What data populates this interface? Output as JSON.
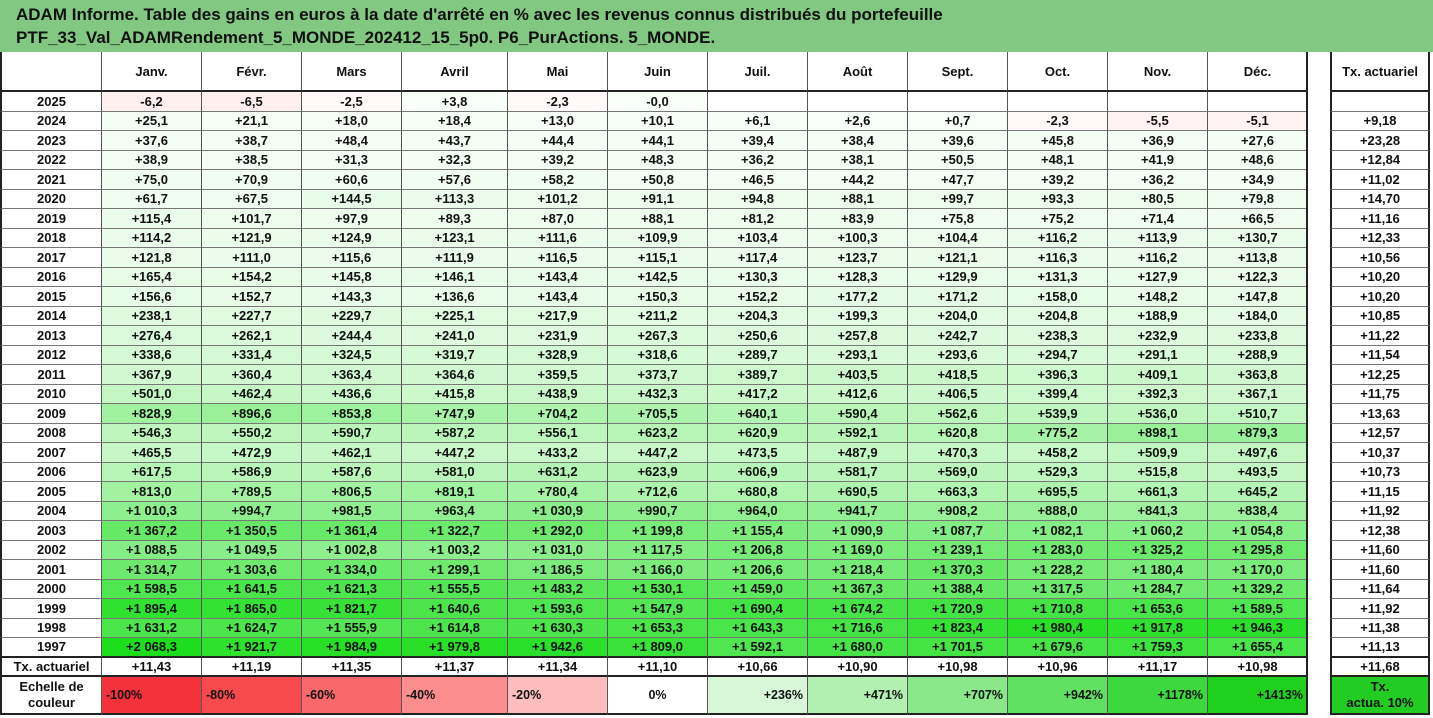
{
  "title_line1": "ADAM Informe. Table des gains en euros à la date d'arrêté en % avec les revenus connus distribués du portefeuille",
  "title_line2": "PTF_33_Val_ADAMRendement_5_MONDE_202412_15_5p0. P6_PurActions. 5_MONDE.",
  "months": [
    "Janv.",
    "Févr.",
    "Mars",
    "Avril",
    "Mai",
    "Juin",
    "Juil.",
    "Août",
    "Sept.",
    "Oct.",
    "Nov.",
    "Déc."
  ],
  "tx_header": "Tx. actuariel",
  "rows": [
    {
      "year": "2025",
      "values": [
        "-6,2",
        "-6,5",
        "-2,5",
        "+3,8",
        "-2,3",
        "-0,0",
        "",
        "",
        "",
        "",
        "",
        ""
      ],
      "tx": ""
    },
    {
      "year": "2024",
      "values": [
        "+25,1",
        "+21,1",
        "+18,0",
        "+18,4",
        "+13,0",
        "+10,1",
        "+6,1",
        "+2,6",
        "+0,7",
        "-2,3",
        "-5,5",
        "-5,1"
      ],
      "tx": "+9,18"
    },
    {
      "year": "2023",
      "values": [
        "+37,6",
        "+38,7",
        "+48,4",
        "+43,7",
        "+44,4",
        "+44,1",
        "+39,4",
        "+38,4",
        "+39,6",
        "+45,8",
        "+36,9",
        "+27,6"
      ],
      "tx": "+23,28"
    },
    {
      "year": "2022",
      "values": [
        "+38,9",
        "+38,5",
        "+31,3",
        "+32,3",
        "+39,2",
        "+48,3",
        "+36,2",
        "+38,1",
        "+50,5",
        "+48,1",
        "+41,9",
        "+48,6"
      ],
      "tx": "+12,84"
    },
    {
      "year": "2021",
      "values": [
        "+75,0",
        "+70,9",
        "+60,6",
        "+57,6",
        "+58,2",
        "+50,8",
        "+46,5",
        "+44,2",
        "+47,7",
        "+39,2",
        "+36,2",
        "+34,9"
      ],
      "tx": "+11,02"
    },
    {
      "year": "2020",
      "values": [
        "+61,7",
        "+67,5",
        "+144,5",
        "+113,3",
        "+101,2",
        "+91,1",
        "+94,8",
        "+88,1",
        "+99,7",
        "+93,3",
        "+80,5",
        "+79,8"
      ],
      "tx": "+14,70"
    },
    {
      "year": "2019",
      "values": [
        "+115,4",
        "+101,7",
        "+97,9",
        "+89,3",
        "+87,0",
        "+88,1",
        "+81,2",
        "+83,9",
        "+75,8",
        "+75,2",
        "+71,4",
        "+66,5"
      ],
      "tx": "+11,16"
    },
    {
      "year": "2018",
      "values": [
        "+114,2",
        "+121,9",
        "+124,9",
        "+123,1",
        "+111,6",
        "+109,9",
        "+103,4",
        "+100,3",
        "+104,4",
        "+116,2",
        "+113,9",
        "+130,7"
      ],
      "tx": "+12,33"
    },
    {
      "year": "2017",
      "values": [
        "+121,8",
        "+111,0",
        "+115,6",
        "+111,9",
        "+116,5",
        "+115,1",
        "+117,4",
        "+123,7",
        "+121,1",
        "+116,3",
        "+116,2",
        "+113,8"
      ],
      "tx": "+10,56"
    },
    {
      "year": "2016",
      "values": [
        "+165,4",
        "+154,2",
        "+145,8",
        "+146,1",
        "+143,4",
        "+142,5",
        "+130,3",
        "+128,3",
        "+129,9",
        "+131,3",
        "+127,9",
        "+122,3"
      ],
      "tx": "+10,20"
    },
    {
      "year": "2015",
      "values": [
        "+156,6",
        "+152,7",
        "+143,3",
        "+136,6",
        "+143,4",
        "+150,3",
        "+152,2",
        "+177,2",
        "+171,2",
        "+158,0",
        "+148,2",
        "+147,8"
      ],
      "tx": "+10,20"
    },
    {
      "year": "2014",
      "values": [
        "+238,1",
        "+227,7",
        "+229,7",
        "+225,1",
        "+217,9",
        "+211,2",
        "+204,3",
        "+199,3",
        "+204,0",
        "+204,8",
        "+188,9",
        "+184,0"
      ],
      "tx": "+10,85"
    },
    {
      "year": "2013",
      "values": [
        "+276,4",
        "+262,1",
        "+244,4",
        "+241,0",
        "+231,9",
        "+267,3",
        "+250,6",
        "+257,8",
        "+242,7",
        "+238,3",
        "+232,9",
        "+233,8"
      ],
      "tx": "+11,22"
    },
    {
      "year": "2012",
      "values": [
        "+338,6",
        "+331,4",
        "+324,5",
        "+319,7",
        "+328,9",
        "+318,6",
        "+289,7",
        "+293,1",
        "+293,6",
        "+294,7",
        "+291,1",
        "+288,9"
      ],
      "tx": "+11,54"
    },
    {
      "year": "2011",
      "values": [
        "+367,9",
        "+360,4",
        "+363,4",
        "+364,6",
        "+359,5",
        "+373,7",
        "+389,7",
        "+403,5",
        "+418,5",
        "+396,3",
        "+409,1",
        "+363,8"
      ],
      "tx": "+12,25"
    },
    {
      "year": "2010",
      "values": [
        "+501,0",
        "+462,4",
        "+436,6",
        "+415,8",
        "+438,9",
        "+432,3",
        "+417,2",
        "+412,6",
        "+406,5",
        "+399,4",
        "+392,3",
        "+367,1"
      ],
      "tx": "+11,75"
    },
    {
      "year": "2009",
      "values": [
        "+828,9",
        "+896,6",
        "+853,8",
        "+747,9",
        "+704,2",
        "+705,5",
        "+640,1",
        "+590,4",
        "+562,6",
        "+539,9",
        "+536,0",
        "+510,7"
      ],
      "tx": "+13,63"
    },
    {
      "year": "2008",
      "values": [
        "+546,3",
        "+550,2",
        "+590,7",
        "+587,2",
        "+556,1",
        "+623,2",
        "+620,9",
        "+592,1",
        "+620,8",
        "+775,2",
        "+898,1",
        "+879,3"
      ],
      "tx": "+12,57"
    },
    {
      "year": "2007",
      "values": [
        "+465,5",
        "+472,9",
        "+462,1",
        "+447,2",
        "+433,2",
        "+447,2",
        "+473,5",
        "+487,9",
        "+470,3",
        "+458,2",
        "+509,9",
        "+497,6"
      ],
      "tx": "+10,37"
    },
    {
      "year": "2006",
      "values": [
        "+617,5",
        "+586,9",
        "+587,6",
        "+581,0",
        "+631,2",
        "+623,9",
        "+606,9",
        "+581,7",
        "+569,0",
        "+529,3",
        "+515,8",
        "+493,5"
      ],
      "tx": "+10,73"
    },
    {
      "year": "2005",
      "values": [
        "+813,0",
        "+789,5",
        "+806,5",
        "+819,1",
        "+780,4",
        "+712,6",
        "+680,8",
        "+690,5",
        "+663,3",
        "+695,5",
        "+661,3",
        "+645,2"
      ],
      "tx": "+11,15"
    },
    {
      "year": "2004",
      "values": [
        "+1 010,3",
        "+994,7",
        "+981,5",
        "+963,4",
        "+1 030,9",
        "+990,7",
        "+964,0",
        "+941,7",
        "+908,2",
        "+888,0",
        "+841,3",
        "+838,4"
      ],
      "tx": "+11,92"
    },
    {
      "year": "2003",
      "values": [
        "+1 367,2",
        "+1 350,5",
        "+1 361,4",
        "+1 322,7",
        "+1 292,0",
        "+1 199,8",
        "+1 155,4",
        "+1 090,9",
        "+1 087,7",
        "+1 082,1",
        "+1 060,2",
        "+1 054,8"
      ],
      "tx": "+12,38"
    },
    {
      "year": "2002",
      "values": [
        "+1 088,5",
        "+1 049,5",
        "+1 002,8",
        "+1 003,2",
        "+1 031,0",
        "+1 117,5",
        "+1 206,8",
        "+1 169,0",
        "+1 239,1",
        "+1 283,0",
        "+1 325,2",
        "+1 295,8"
      ],
      "tx": "+11,60"
    },
    {
      "year": "2001",
      "values": [
        "+1 314,7",
        "+1 303,6",
        "+1 334,0",
        "+1 299,1",
        "+1 186,5",
        "+1 166,0",
        "+1 206,6",
        "+1 218,4",
        "+1 370,3",
        "+1 228,2",
        "+1 180,4",
        "+1 170,0"
      ],
      "tx": "+11,60"
    },
    {
      "year": "2000",
      "values": [
        "+1 598,5",
        "+1 641,5",
        "+1 621,3",
        "+1 555,5",
        "+1 483,2",
        "+1 530,1",
        "+1 459,0",
        "+1 367,3",
        "+1 388,4",
        "+1 317,5",
        "+1 284,7",
        "+1 329,2"
      ],
      "tx": "+11,64"
    },
    {
      "year": "1999",
      "values": [
        "+1 895,4",
        "+1 865,0",
        "+1 821,7",
        "+1 640,6",
        "+1 593,6",
        "+1 547,9",
        "+1 690,4",
        "+1 674,2",
        "+1 720,9",
        "+1 710,8",
        "+1 653,6",
        "+1 589,5"
      ],
      "tx": "+11,92"
    },
    {
      "year": "1998",
      "values": [
        "+1 631,2",
        "+1 624,7",
        "+1 555,9",
        "+1 614,8",
        "+1 630,3",
        "+1 653,3",
        "+1 643,3",
        "+1 716,6",
        "+1 823,4",
        "+1 980,4",
        "+1 917,8",
        "+1 946,3"
      ],
      "tx": "+11,38"
    },
    {
      "year": "1997",
      "values": [
        "+2 068,3",
        "+1 921,7",
        "+1 984,9",
        "+1 979,8",
        "+1 942,6",
        "+1 809,0",
        "+1 592,1",
        "+1 680,0",
        "+1 701,5",
        "+1 679,6",
        "+1 759,3",
        "+1 655,4"
      ],
      "tx": "+11,13"
    }
  ],
  "tx_row": {
    "label": "Tx. actuariel",
    "values": [
      "+11,43",
      "+11,19",
      "+11,35",
      "+11,37",
      "+11,34",
      "+11,10",
      "+10,66",
      "+10,90",
      "+10,98",
      "+10,96",
      "+11,17",
      "+10,98"
    ],
    "tx": "+11,68"
  },
  "scale_row": {
    "label_line1": "Echelle de",
    "label_line2": "couleur",
    "items": [
      "-100%",
      "-80%",
      "-60%",
      "-40%",
      "-20%",
      "0%",
      "+236%",
      "+471%",
      "+707%",
      "+942%",
      "+1178%",
      "+1413%"
    ],
    "colors": [
      "#f4323c",
      "#f74a4f",
      "#f9686b",
      "#fb8d8f",
      "#fdbcbd",
      "#ffffff",
      "#d8f7d8",
      "#b2f0b2",
      "#8ae88a",
      "#62e062",
      "#3dd83d",
      "#1fd01f"
    ],
    "tx_line1": "Tx.",
    "tx_line2": "actua. 10%",
    "tx_color": "#22cc22"
  },
  "colors": {
    "header_bg": "#82c882"
  }
}
